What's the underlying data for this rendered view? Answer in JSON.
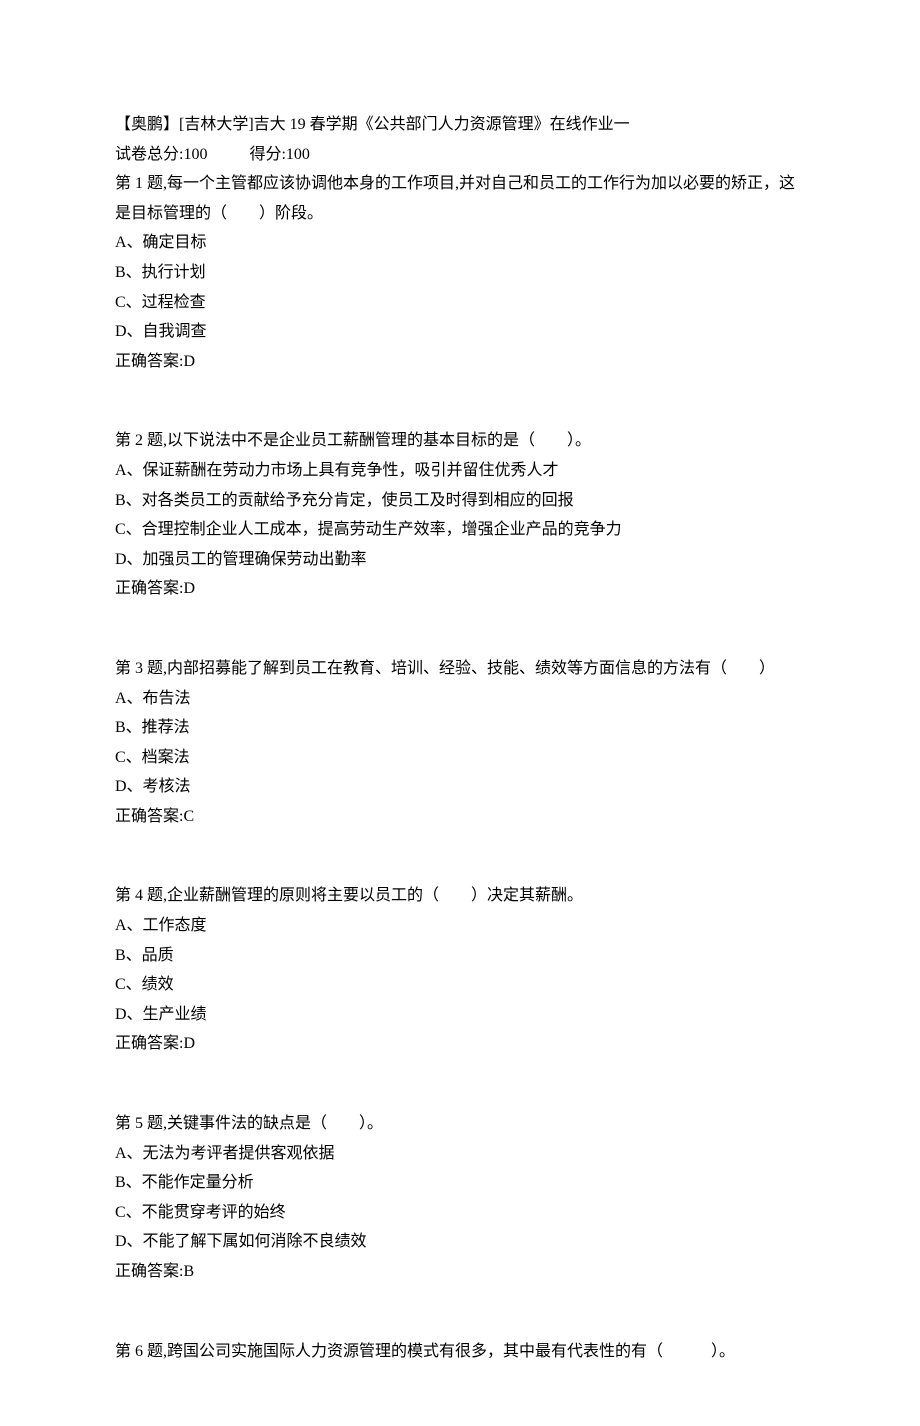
{
  "header": {
    "title": "【奥鹏】[吉林大学]吉大 19 春学期《公共部门人力资源管理》在线作业一",
    "score_total_label": "试卷总分:100",
    "score_got_label": "得分:100"
  },
  "questions": [
    {
      "prompt": "第 1 题,每一个主管都应该协调他本身的工作项目,并对自己和员工的工作行为加以必要的矫正，这是目标管理的（　　）阶段。",
      "options": [
        "A、确定目标",
        "B、执行计划",
        "C、过程检查",
        "D、自我调查"
      ],
      "answer": "正确答案:D"
    },
    {
      "prompt": "第 2 题,以下说法中不是企业员工薪酬管理的基本目标的是（　　）。",
      "options": [
        "A、保证薪酬在劳动力市场上具有竞争性，吸引并留住优秀人才",
        "B、对各类员工的贡献给予充分肯定，使员工及时得到相应的回报",
        "C、合理控制企业人工成本，提高劳动生产效率，增强企业产品的竞争力",
        "D、加强员工的管理确保劳动出勤率"
      ],
      "answer": "正确答案:D"
    },
    {
      "prompt": "第 3 题,内部招募能了解到员工在教育、培训、经验、技能、绩效等方面信息的方法有（　　）",
      "options": [
        "A、布告法",
        "B、推荐法",
        "C、档案法",
        "D、考核法"
      ],
      "answer": "正确答案:C"
    },
    {
      "prompt": "第 4 题,企业薪酬管理的原则将主要以员工的（　　）决定其薪酬。",
      "options": [
        "A、工作态度",
        "B、品质",
        "C、绩效",
        "D、生产业绩"
      ],
      "answer": "正确答案:D"
    },
    {
      "prompt": "第 5 题,关键事件法的缺点是（　　）。",
      "options": [
        "A、无法为考评者提供客观依据",
        "B、不能作定量分析",
        "C、不能贯穿考评的始终",
        "D、不能了解下属如何消除不良绩效"
      ],
      "answer": "正确答案:B"
    },
    {
      "prompt": "第 6 题,跨国公司实施国际人力资源管理的模式有很多，其中最有代表性的有（　　　）。",
      "options": [],
      "answer": ""
    }
  ]
}
